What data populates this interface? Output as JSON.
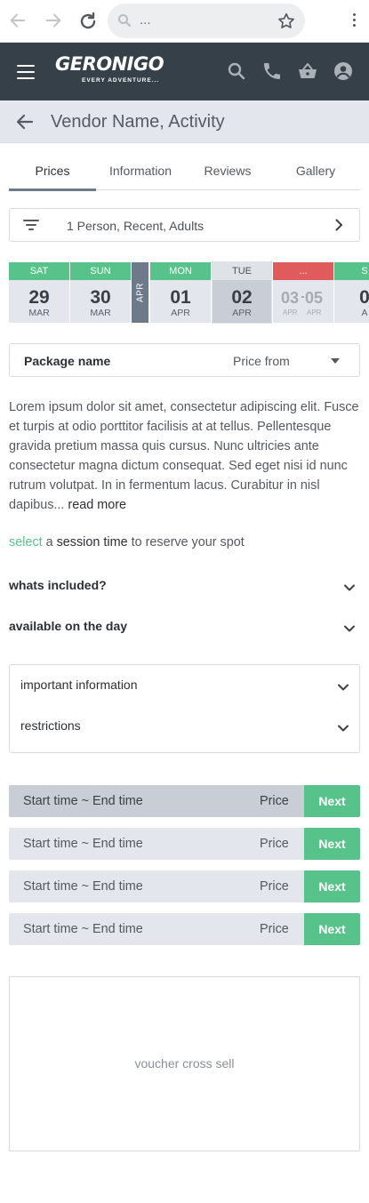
{
  "browser": {
    "url_text": "..."
  },
  "header": {
    "logo_main": "GERONIGO",
    "logo_sub": "EVERY ADVENTURE..."
  },
  "title_bar": {
    "title": "Vendor Name, Activity"
  },
  "tabs": [
    {
      "label": "Prices",
      "active": true
    },
    {
      "label": "Information",
      "active": false
    },
    {
      "label": "Reviews",
      "active": false
    },
    {
      "label": "Gallery",
      "active": false
    }
  ],
  "filter": {
    "summary": "1 Person, Recent, Adults"
  },
  "dates": {
    "cells": [
      {
        "day": "SAT",
        "num": "29",
        "month": "MAR",
        "state": "available"
      },
      {
        "day": "SUN",
        "num": "30",
        "month": "MAR",
        "state": "available"
      },
      {
        "day": "MON",
        "num": "01",
        "month": "APR",
        "state": "available"
      },
      {
        "day": "TUE",
        "num": "02",
        "month": "APR",
        "state": "selected"
      },
      {
        "day": "...",
        "num_from": "03",
        "num_to": "05",
        "month_from": "APR",
        "month_to": "APR",
        "state": "unavailable"
      },
      {
        "day": "S",
        "num": "0",
        "month": "A",
        "state": "available"
      }
    ],
    "month_separator": "APR"
  },
  "package": {
    "label": "Package name",
    "price_label": "Price from"
  },
  "description": {
    "text": "Lorem ipsum dolor sit amet, consectetur adipiscing elit. Fusce et turpis at odio porttitor facilisis at at tellus. Pellentesque gravida pretium massa quis cursus. Nunc ultricies ante consectetur magna dictum consequat. Sed eget nisi id nunc rutrum volutpat. In in fermentum lacus. Curabitur in nisl dapibus...",
    "read_more": "read more"
  },
  "session_prompt": {
    "select": "select",
    "a": " a ",
    "session_time": "session time",
    "rest": " to reserve your spot"
  },
  "accordions": [
    {
      "label": "whats included?"
    },
    {
      "label": "available on the day"
    }
  ],
  "info_box": [
    {
      "label": "important information"
    },
    {
      "label": "restrictions"
    }
  ],
  "sessions": [
    {
      "time": "Start time ~ End time",
      "price": "Price",
      "action": "Next"
    },
    {
      "time": "Start time ~ End time",
      "price": "Price",
      "action": "Next"
    },
    {
      "time": "Start time ~ End time",
      "price": "Price",
      "action": "Next"
    },
    {
      "time": "Start time ~ End time",
      "price": "Price",
      "action": "Next"
    }
  ],
  "cross_sell": {
    "text": "voucher cross sell"
  },
  "colors": {
    "header_bg": "#354048",
    "accent_green": "#57c38b",
    "unavailable_red": "#e05b5b",
    "title_bar_bg": "#e3e6ed",
    "month_separator_bg": "#6d7a8a"
  }
}
